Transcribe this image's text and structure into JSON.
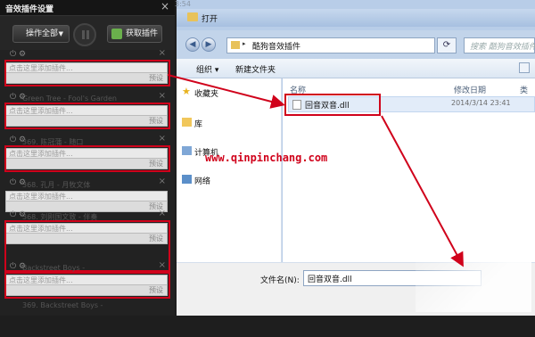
{
  "left_panel": {
    "title": "音效插件设置",
    "close": "×",
    "operate_all": "操作全部",
    "get_plugin": "获取插件",
    "slots": [
      {
        "add_text": "点击这里添加插件...",
        "preset": "预设",
        "ghost": "Green Tree - Fool's Garden"
      },
      {
        "add_text": "点击这里添加插件...",
        "preset": "预设",
        "ghost": "369. 陈冠蒲 - 随口"
      },
      {
        "add_text": "点击这里添加插件...",
        "preset": "预设",
        "ghost": ""
      },
      {
        "add_text": "点击这里添加插件...",
        "preset": "预设",
        "ghost": "368. 孔月 - 月牧文体"
      },
      {
        "add_text": "点击这里添加插件...",
        "preset": "预设",
        "ghost": "368. 刘刚国文致 - 伴奏"
      },
      {
        "add_text": "点击这里添加插件...",
        "preset": "预设",
        "ghost": "Backstreet Boys -"
      },
      {
        "add_text": "点击这里添加插件...",
        "preset": "预设",
        "ghost": "369. Backstreet Boys -"
      }
    ]
  },
  "dialog": {
    "time_fragment": "3:54",
    "title": "打开",
    "address": "酷狗音效插件",
    "search_placeholder": "搜索 酷狗音效插件",
    "organize": "组织 ▾",
    "new_folder": "新建文件夹",
    "nav": [
      "收藏夹",
      "库",
      "计算机",
      "网络"
    ],
    "columns": {
      "name": "名称",
      "modified": "修改日期",
      "type": "类"
    },
    "file": {
      "name": "回音双音.dll",
      "date": "2014/3/14 23:41"
    },
    "filename_label": "文件名(N):",
    "filename_value": "回音双音.dll"
  },
  "watermark": "www.qinpinchang.com",
  "colors": {
    "highlight": "#d0021b",
    "panel_bg": "#222222",
    "dialog_frame": "#b8cde8"
  }
}
